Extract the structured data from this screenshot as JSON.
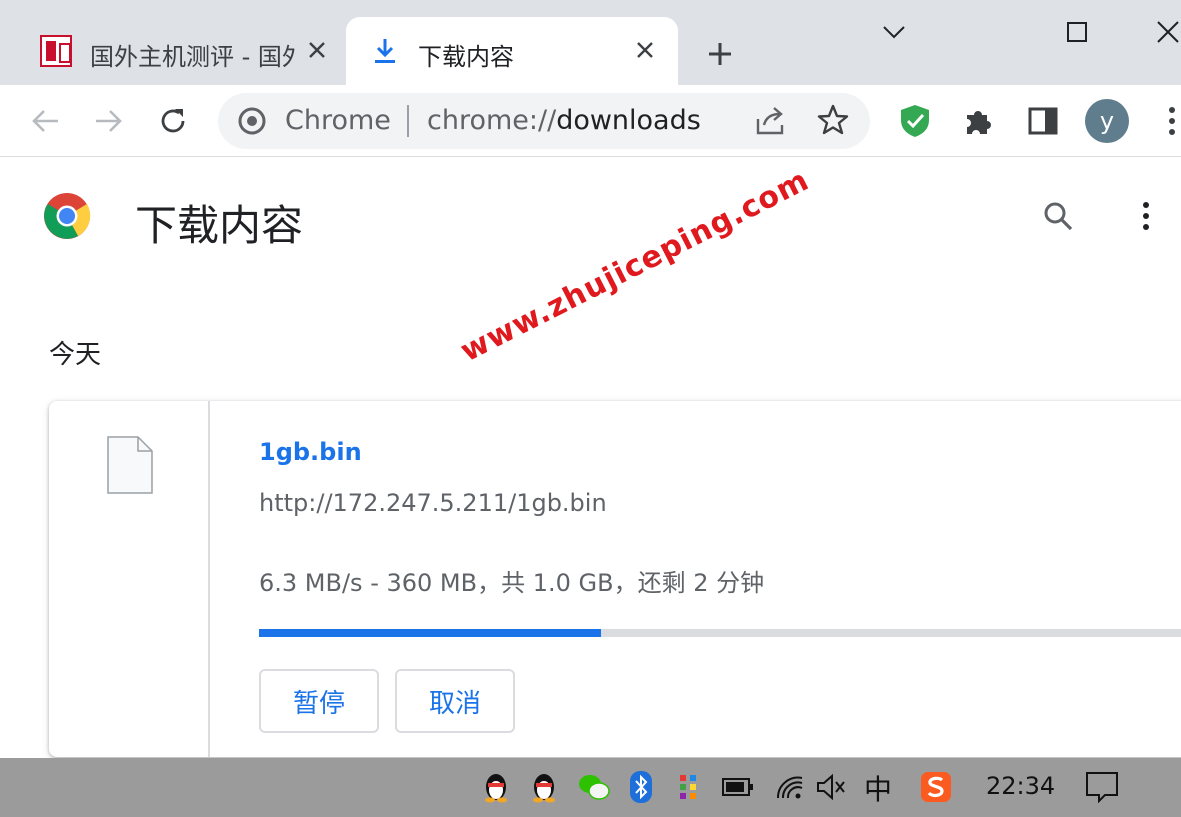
{
  "tabs": [
    {
      "title": "国外主机测评 - 国外",
      "active": false
    },
    {
      "title": "下载内容",
      "active": true
    }
  ],
  "omnibox": {
    "site_label": "Chrome",
    "url_scheme": "chrome://",
    "url_path": "downloads"
  },
  "profile": {
    "initial": "y"
  },
  "page": {
    "title": "下载内容",
    "date_heading": "今天"
  },
  "download": {
    "file_name": "1gb.bin",
    "url": "http://172.247.5.211/1gb.bin",
    "status": "6.3 MB/s - 360 MB，共 1.0 GB，还剩 2 分钟",
    "progress": 0.36,
    "pause_label": "暂停",
    "cancel_label": "取消"
  },
  "watermark": "www.zhujiceping.com",
  "taskbar": {
    "ime_label": "中",
    "time": "22:34"
  },
  "colors": {
    "accent": "#1a73e8",
    "tabstrip": "#dee1e6",
    "watermark": "#e0191e",
    "taskbar": "#9b9b9b"
  }
}
